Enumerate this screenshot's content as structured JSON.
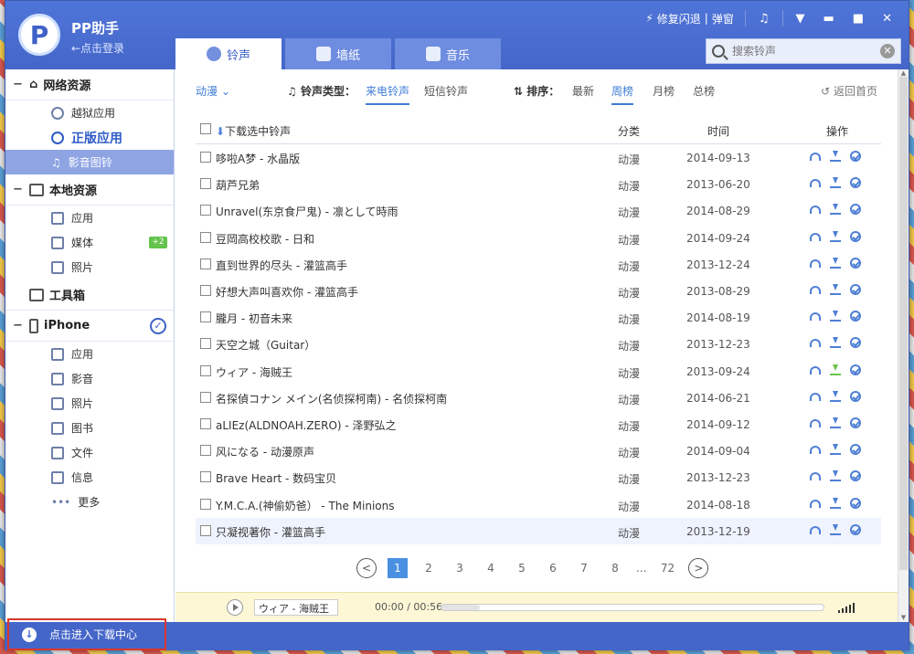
{
  "app": {
    "title": "PP助手",
    "login": "←点击登录",
    "logo_letter": "P"
  },
  "window_controls": {
    "fix": "修复闪退",
    "popup": "弹窗",
    "music_icon": "music-note-icon",
    "menu_icon": "dropdown-menu-icon",
    "minimize": "minimize-icon",
    "maximize": "maximize-icon",
    "close": "close-icon"
  },
  "tabs": [
    {
      "label": "铃声",
      "active": true
    },
    {
      "label": "墙纸",
      "active": false
    },
    {
      "label": "音乐",
      "active": false
    }
  ],
  "search": {
    "placeholder": "搜索铃声"
  },
  "sidebar": {
    "net_resources": "网络资源",
    "jailbreak_apps": "越狱应用",
    "official_apps": "正版应用",
    "media_ringtones": "影音图铃",
    "local_resources": "本地资源",
    "local_apps": "应用",
    "local_media": "媒体",
    "local_media_badge": "+2",
    "local_photos": "照片",
    "toolbox": "工具箱",
    "device": "iPhone",
    "device_apps": "应用",
    "device_media": "影音",
    "device_photos": "照片",
    "device_books": "图书",
    "device_files": "文件",
    "device_messages": "信息",
    "device_more": "更多"
  },
  "download_center": "点击进入下载中心",
  "filter": {
    "category": "动漫",
    "type_label": "铃声类型：",
    "type_call": "来电铃声",
    "type_sms": "短信铃声",
    "sort_label": "排序：",
    "sort_new": "最新",
    "sort_week": "周榜",
    "sort_month": "月榜",
    "sort_total": "总榜",
    "back_home": "返回首页"
  },
  "list_head": {
    "download_selected": "下载选中铃声",
    "category": "分类",
    "time": "时间",
    "ops": "操作"
  },
  "rows": [
    {
      "title": "哆啦A梦 - 水晶版",
      "cat": "动漫",
      "date": "2014-09-13"
    },
    {
      "title": "葫芦兄弟",
      "cat": "动漫",
      "date": "2013-06-20"
    },
    {
      "title": "Unravel(东京食尸鬼) - 凛として時雨",
      "cat": "动漫",
      "date": "2014-08-29"
    },
    {
      "title": "豆岡高校校歌 - 日和",
      "cat": "动漫",
      "date": "2014-09-24"
    },
    {
      "title": "直到世界的尽头 - 灌篮高手",
      "cat": "动漫",
      "date": "2013-12-24"
    },
    {
      "title": "好想大声叫喜欢你 - 灌篮高手",
      "cat": "动漫",
      "date": "2013-08-29"
    },
    {
      "title": "朧月 - 初音未来",
      "cat": "动漫",
      "date": "2014-08-19"
    },
    {
      "title": "天空之城（Guitar）",
      "cat": "动漫",
      "date": "2013-12-23"
    },
    {
      "title": "ウィア - 海贼王",
      "cat": "动漫",
      "date": "2013-09-24"
    },
    {
      "title": "名探偵コナン メイン(名侦探柯南) - 名侦探柯南",
      "cat": "动漫",
      "date": "2014-06-21"
    },
    {
      "title": "aLIEz(ALDNOAH.ZERO) - 泽野弘之",
      "cat": "动漫",
      "date": "2014-09-12"
    },
    {
      "title": "风になる - 动漫原声",
      "cat": "动漫",
      "date": "2014-09-04"
    },
    {
      "title": "Brave Heart - 数码宝贝",
      "cat": "动漫",
      "date": "2013-12-23"
    },
    {
      "title": "Y.M.C.A.(神偷奶爸） - The Minions",
      "cat": "动漫",
      "date": "2014-08-18"
    },
    {
      "title": "只凝视著你 - 灌篮高手",
      "cat": "动漫",
      "date": "2013-12-19"
    }
  ],
  "pager": {
    "pages": [
      "1",
      "2",
      "3",
      "4",
      "5",
      "6",
      "7",
      "8"
    ],
    "ellipsis": "...",
    "last": "72",
    "current": "1"
  },
  "player": {
    "now_playing": "ウィア - 海贼王",
    "time": "00:00 / 00:56",
    "progress": 0.1
  }
}
